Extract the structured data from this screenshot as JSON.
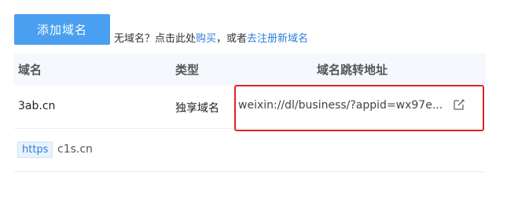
{
  "toolbar": {
    "add_domain_label": "添加域名",
    "hint_prefix": "无域名？点击此处",
    "buy_link": "购买",
    "hint_middle": "，或者",
    "register_link": "去注册新域名"
  },
  "table": {
    "headers": [
      "域名",
      "类型",
      "域名跳转地址"
    ],
    "rows": [
      {
        "domain": "3ab.cn",
        "type": "独享域名",
        "redirect_url": "weixin://dl/business/?appid=wx97e..."
      }
    ],
    "row2": {
      "badge": "https",
      "domain": "c1s.cn"
    }
  },
  "colors": {
    "accent": "#4a9ff0",
    "link": "#2f7fd6",
    "highlight_border": "#e02424",
    "header_bg": "#f5f8fc"
  },
  "icons": {
    "edit": "edit-icon"
  }
}
